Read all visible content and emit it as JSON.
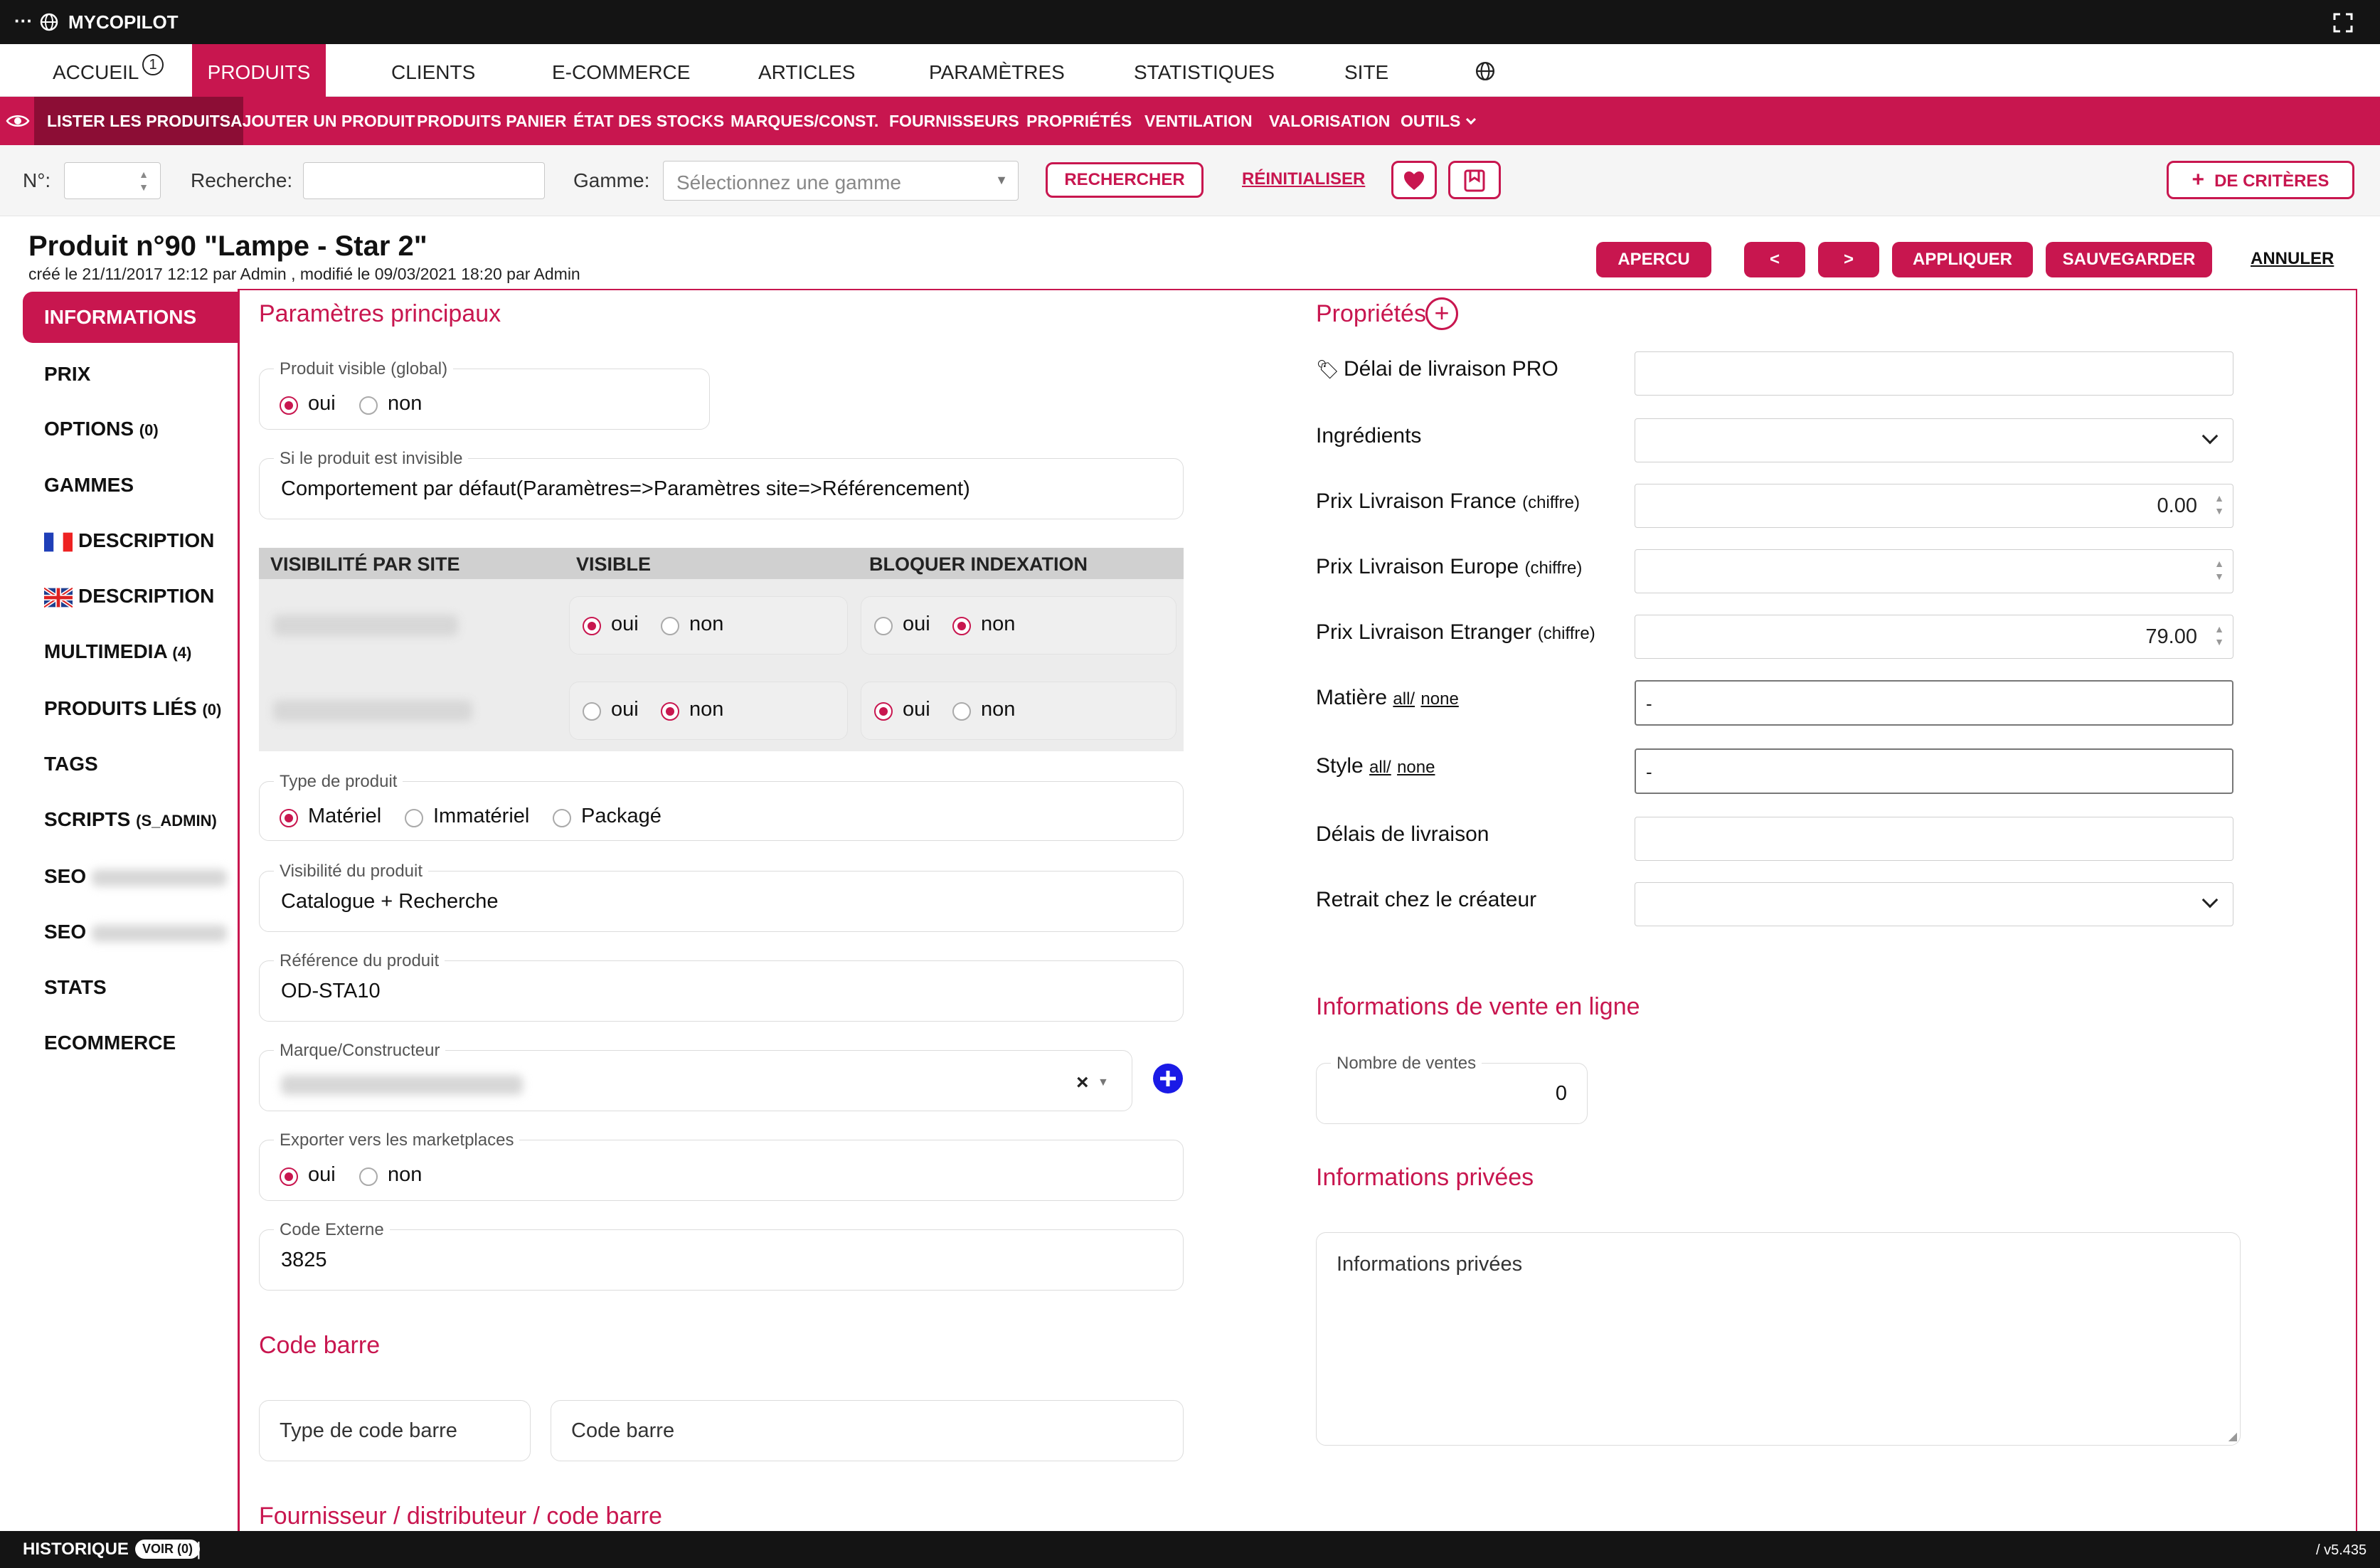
{
  "app": {
    "name": "MYCOPILOT",
    "dots": "···",
    "version": "/ v5.435"
  },
  "mainnav": {
    "items": [
      "ACCUEIL",
      "PRODUITS",
      "CLIENTS",
      "E-COMMERCE",
      "ARTICLES",
      "PARAMÈTRES",
      "STATISTIQUES",
      "SITE"
    ],
    "badge": "1",
    "active": "PRODUITS"
  },
  "subnav": {
    "items": [
      "LISTER LES PRODUITS",
      "AJOUTER UN PRODUIT",
      "PRODUITS PANIER",
      "ÉTAT DES STOCKS",
      "MARQUES/CONST.",
      "FOURNISSEURS",
      "PROPRIÉTÉS",
      "VENTILATION",
      "VALORISATION",
      "OUTILS"
    ],
    "active": "LISTER LES PRODUITS"
  },
  "filters": {
    "num_label": "N°:",
    "search_label": "Recherche:",
    "gamme_label": "Gamme:",
    "gamme_placeholder": "Sélectionnez une gamme",
    "search_btn": "RECHERCHER",
    "reset_btn": "RÉINITIALISER",
    "criteria_btn": "DE CRITÈRES"
  },
  "product": {
    "title": "Produit n°90 \"Lampe - Star 2\"",
    "meta": "créé le 21/11/2017 12:12 par Admin , modifié le 09/03/2021 18:20 par Admin"
  },
  "actions": {
    "preview": "APERCU",
    "prev": "<",
    "next": ">",
    "apply": "APPLIQUER",
    "save": "SAUVEGARDER",
    "cancel": "ANNULER"
  },
  "sidebar": {
    "items": [
      "INFORMATIONS",
      "PRIX",
      "OPTIONS",
      "GAMMES",
      "DESCRIPTION",
      "DESCRIPTION",
      "MULTIMEDIA",
      "PRODUITS LIÉS",
      "TAGS",
      "SCRIPTS",
      "SEO",
      "SEO",
      "STATS",
      "ECOMMERCE"
    ],
    "counts": {
      "options": "(0)",
      "multimedia": "(4)",
      "liés": "(0)",
      "scripts": "(S_ADMIN)"
    }
  },
  "main": {
    "section_title": "Paramètres principaux",
    "visible_global": {
      "legend": "Produit visible (global)",
      "yes": "oui",
      "no": "non",
      "value": "oui"
    },
    "invisible": {
      "legend": "Si le produit est invisible",
      "value": "Comportement par défaut(Paramètres=>Paramètres site=>Référencement)"
    },
    "site_table": {
      "headers": [
        "VISIBILITÉ PAR SITE",
        "VISIBLE",
        "BLOQUER INDEXATION"
      ],
      "rows": [
        {
          "visible": "oui",
          "bloquer": "non"
        },
        {
          "visible": "non",
          "bloquer": "oui"
        }
      ],
      "yes": "oui",
      "no": "non"
    },
    "type": {
      "legend": "Type de produit",
      "options": [
        "Matériel",
        "Immatériel",
        "Packagé"
      ],
      "value": "Matériel"
    },
    "visibility": {
      "legend": "Visibilité du produit",
      "value": "Catalogue + Recherche"
    },
    "reference": {
      "legend": "Référence du produit",
      "value": "OD-STA10"
    },
    "brand": {
      "legend": "Marque/Constructeur",
      "clear": "×"
    },
    "export": {
      "legend": "Exporter vers les marketplaces",
      "yes": "oui",
      "no": "non",
      "value": "oui"
    },
    "code_ext": {
      "legend": "Code Externe",
      "value": "3825"
    },
    "barcode_title": "Code barre",
    "barcode_type": "Type de code barre",
    "barcode": "Code barre",
    "supplier_title": "Fournisseur / distributeur / code barre"
  },
  "props": {
    "title": "Propriétés",
    "rows": [
      {
        "label": "Délai de livraison PRO",
        "suffix": "",
        "value": ""
      },
      {
        "label": "Ingrédients",
        "suffix": "",
        "value": ""
      },
      {
        "label": "Prix Livraison France",
        "suffix": "(chiffre)",
        "value": "0.00"
      },
      {
        "label": "Prix Livraison Europe",
        "suffix": "(chiffre)",
        "value": ""
      },
      {
        "label": "Prix Livraison Etranger",
        "suffix": "(chiffre)",
        "value": "79.00"
      },
      {
        "label": "Matière",
        "suffix": "",
        "value": "-"
      },
      {
        "label": "Style",
        "suffix": "",
        "value": "-"
      },
      {
        "label": "Délais de livraison",
        "suffix": "",
        "value": ""
      },
      {
        "label": "Retrait chez le créateur",
        "suffix": "",
        "value": ""
      }
    ],
    "all": "all/",
    "none": "none"
  },
  "online": {
    "title": "Informations de vente en ligne",
    "legend": "Nombre de ventes",
    "value": "0"
  },
  "private": {
    "title": "Informations privées",
    "placeholder": "Informations privées"
  },
  "footer": {
    "history": "HISTORIQUE",
    "voir": "VOIR (0)",
    "sep": "|"
  },
  "colors": {
    "accent": "#c8164f",
    "dark": "#141414"
  }
}
